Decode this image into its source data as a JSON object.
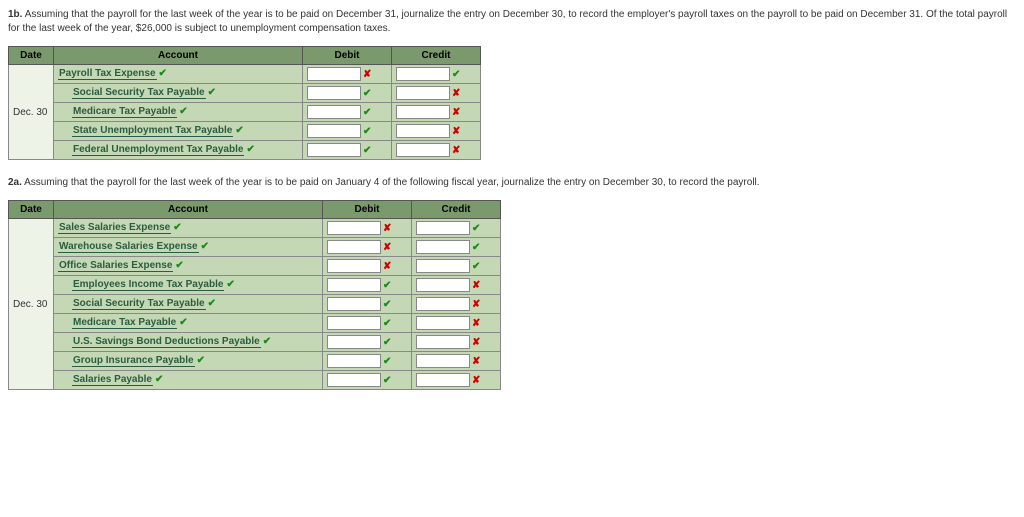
{
  "q1b": {
    "label": "1b.",
    "text": "Assuming that the payroll for the last week of the year is to be paid on December 31, journalize the entry on December 30, to record the employer's payroll taxes on the payroll to be paid on December 31. Of the total payroll for the last week of the year, $26,000 is subject to unemployment compensation taxes."
  },
  "q2a": {
    "label": "2a.",
    "text": "Assuming that the payroll for the last week of the year is to be paid on January 4 of the following fiscal year, journalize the entry on December 30, to record the payroll."
  },
  "cols": {
    "date": "Date",
    "account": "Account",
    "debit": "Debit",
    "credit": "Credit"
  },
  "t1": {
    "date": "Dec. 30",
    "rows": [
      {
        "account": "Payroll Tax Expense",
        "acct_mark": "✔",
        "debit_mark": "✘",
        "credit_mark": "✔",
        "indent": false
      },
      {
        "account": "Social Security Tax Payable",
        "acct_mark": "✔",
        "debit_mark": "✔",
        "credit_mark": "✘",
        "indent": true
      },
      {
        "account": "Medicare Tax Payable",
        "acct_mark": "✔",
        "debit_mark": "✔",
        "credit_mark": "✘",
        "indent": true
      },
      {
        "account": "State Unemployment Tax Payable",
        "acct_mark": "✔",
        "debit_mark": "✔",
        "credit_mark": "✘",
        "indent": true
      },
      {
        "account": "Federal Unemployment Tax Payable",
        "acct_mark": "✔",
        "debit_mark": "✔",
        "credit_mark": "✘",
        "indent": true
      }
    ]
  },
  "t2": {
    "date": "Dec. 30",
    "rows": [
      {
        "account": "Sales Salaries Expense",
        "acct_mark": "✔",
        "debit_mark": "✘",
        "credit_mark": "✔",
        "indent": false
      },
      {
        "account": "Warehouse Salaries Expense",
        "acct_mark": "✔",
        "debit_mark": "✘",
        "credit_mark": "✔",
        "indent": false
      },
      {
        "account": "Office Salaries Expense",
        "acct_mark": "✔",
        "debit_mark": "✘",
        "credit_mark": "✔",
        "indent": false
      },
      {
        "account": "Employees Income Tax Payable",
        "acct_mark": "✔",
        "debit_mark": "✔",
        "credit_mark": "✘",
        "indent": true
      },
      {
        "account": "Social Security Tax Payable",
        "acct_mark": "✔",
        "debit_mark": "✔",
        "credit_mark": "✘",
        "indent": true
      },
      {
        "account": "Medicare Tax Payable",
        "acct_mark": "✔",
        "debit_mark": "✔",
        "credit_mark": "✘",
        "indent": true
      },
      {
        "account": "U.S. Savings Bond Deductions Payable",
        "acct_mark": "✔",
        "debit_mark": "✔",
        "credit_mark": "✘",
        "indent": true
      },
      {
        "account": "Group Insurance Payable",
        "acct_mark": "✔",
        "debit_mark": "✔",
        "credit_mark": "✘",
        "indent": true
      },
      {
        "account": "Salaries Payable",
        "acct_mark": "✔",
        "debit_mark": "✔",
        "credit_mark": "✘",
        "indent": true
      }
    ]
  }
}
